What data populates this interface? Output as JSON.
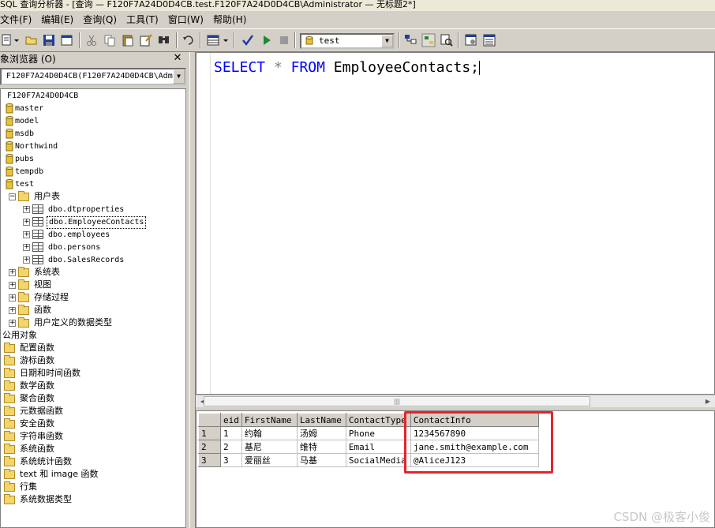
{
  "window": {
    "title": "SQL 查询分析器 - [查询 — F120F7A24D0D4CB.test.F120F7A24D0D4CB\\Administrator — 无标题2*]"
  },
  "menu": [
    "文件(F)",
    "编辑(E)",
    "查询(Q)",
    "工具(T)",
    "窗口(W)",
    "帮助(H)"
  ],
  "toolbar": {
    "database": "test",
    "icons": [
      "new-query-icon",
      "open-icon",
      "save-icon",
      "load-script-icon",
      "cut-icon",
      "copy-icon",
      "paste-icon",
      "clear-icon",
      "find-icon",
      "undo-icon",
      "results-mode-icon",
      "parse-icon",
      "execute-icon",
      "stop-icon",
      "object-browser-icon",
      "object-search-icon",
      "show-plan-icon",
      "options-icon",
      "properties-icon"
    ]
  },
  "object_browser": {
    "title": "象浏览器 (O)",
    "server_select": "F120F7A24D0D4CB(F120F7A24D0D4CB\\Adm",
    "server_node": "F120F7A24D0D4CB",
    "databases": [
      "master",
      "model",
      "msdb",
      "Northwind",
      "pubs",
      "tempdb",
      "test"
    ],
    "user_tables_folder": "用户表",
    "tables": [
      "dbo.dtproperties",
      "dbo.EmployeeContacts",
      "dbo.employees",
      "dbo.persons",
      "dbo.SalesRecords"
    ],
    "folders": [
      "系统表",
      "视图",
      "存储过程",
      "函数",
      "用户定义的数据类型"
    ],
    "common_objects": "公用对象",
    "common_items": [
      "配置函数",
      "游标函数",
      "日期和时间函数",
      "数学函数",
      "聚合函数",
      "元数据函数",
      "安全函数",
      "字符串函数",
      "系统函数",
      "系统统计函数",
      "text 和 image 函数",
      "行集",
      "系统数据类型"
    ]
  },
  "editor": {
    "keyword1": "SELECT",
    "star": "*",
    "keyword2": "FROM",
    "table": "EmployeeContacts;"
  },
  "results": {
    "columns": [
      "eid",
      "FirstName",
      "LastName",
      "ContactType",
      "ContactInfo"
    ],
    "rows": [
      {
        "num": "1",
        "cells": [
          "1",
          "约翰",
          "汤姆",
          "Phone",
          "1234567890"
        ]
      },
      {
        "num": "2",
        "cells": [
          "2",
          "基尼",
          "维特",
          "Email",
          "jane.smith@example.com"
        ]
      },
      {
        "num": "3",
        "cells": [
          "3",
          "爱丽丝",
          "马基",
          "SocialMedia",
          "@AliceJ123"
        ]
      }
    ],
    "highlight_color": "#e8232b"
  },
  "watermark": "CSDN @极客小俊"
}
